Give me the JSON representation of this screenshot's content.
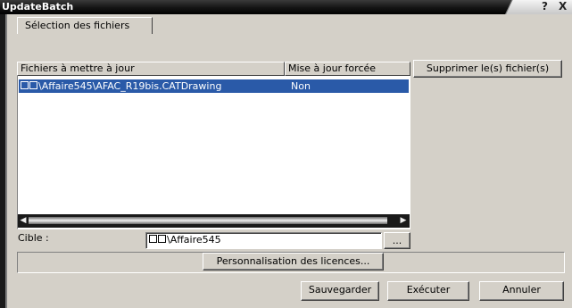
{
  "window": {
    "title": "UpdateBatch",
    "help_symbol": "?",
    "close_symbol": "X"
  },
  "tab": {
    "label": "Sélection des fichiers"
  },
  "list": {
    "columns": [
      "Fichiers à mettre à jour",
      "Mise à jour forcée"
    ],
    "rows": [
      {
        "file": "\\Affaire545\\AFAC_R19bis.CATDrawing",
        "forced": "Non"
      }
    ]
  },
  "buttons": {
    "remove": "Supprimer le(s) fichier(s)",
    "browse": "...",
    "licences": "Personnalisation des licences...",
    "save": "Sauvegarder",
    "run": "Exécuter",
    "cancel": "Annuler"
  },
  "target": {
    "label": "Cible :",
    "value": "\\Affaire545"
  },
  "colors": {
    "selection": "#2a5aa8",
    "dialog_bg": "#d4d0c8",
    "title_bg": "#000000"
  },
  "icons": [
    "help-icon",
    "close-icon",
    "scroll-left-icon",
    "scroll-right-icon"
  ]
}
